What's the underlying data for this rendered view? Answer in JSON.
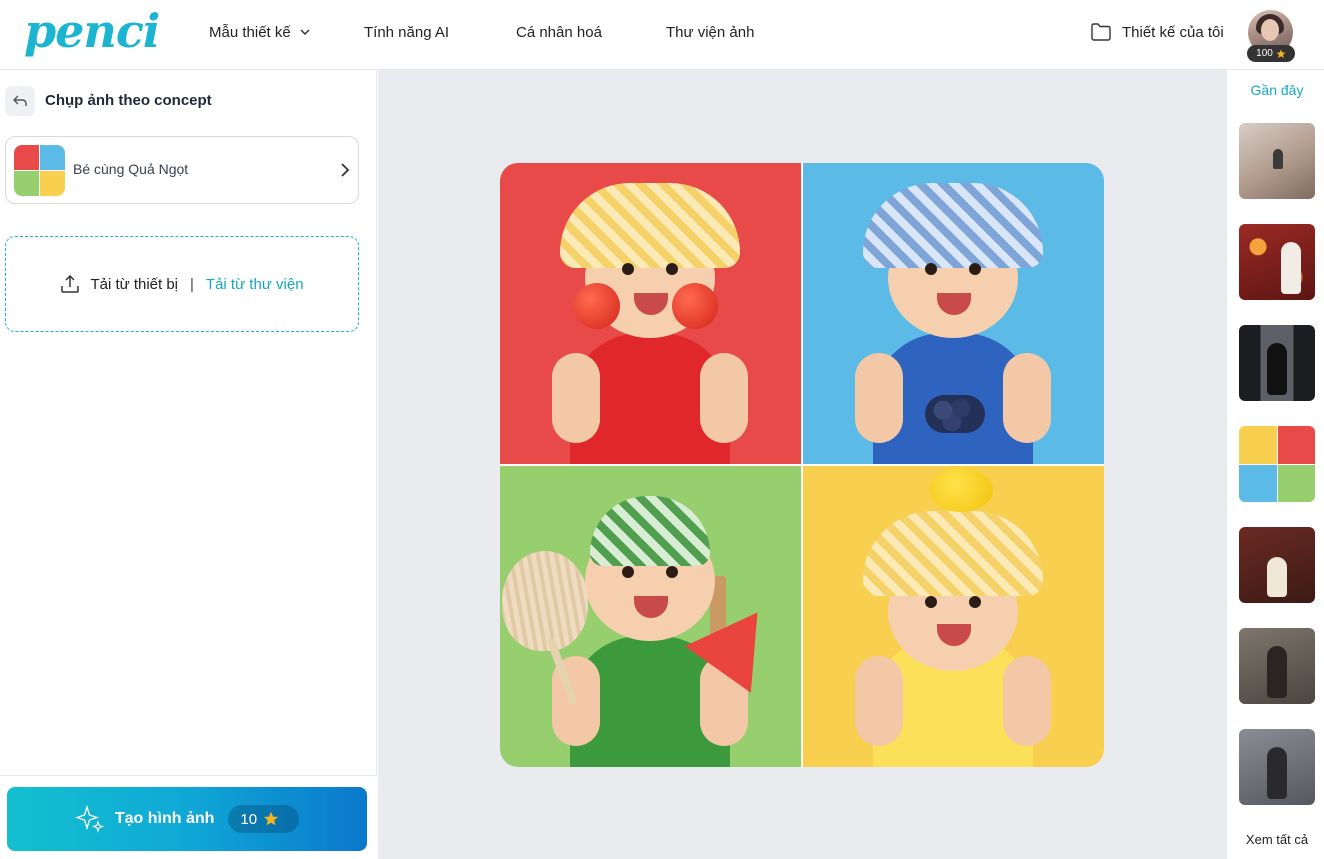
{
  "header": {
    "logo": "penci",
    "nav": [
      {
        "label": "Mẫu thiết kế",
        "has_dropdown": true
      },
      {
        "label": "Tính năng AI"
      },
      {
        "label": "Cá nhân hoá"
      },
      {
        "label": "Thư viện ảnh"
      }
    ],
    "my_designs": "Thiết kế của tôi",
    "credits": "100"
  },
  "sidebar": {
    "title": "Chụp ảnh theo concept",
    "concept_name": "Bé cùng Quả Ngọt",
    "upload_device": "Tải từ thiết bị",
    "upload_separator": "|",
    "upload_library": "Tải từ thư viện",
    "generate_label": "Tạo hình ảnh",
    "generate_cost": "10"
  },
  "recent": {
    "label": "Gần đây",
    "see_all": "Xem tất cả"
  },
  "colors": {
    "brand": "#1cb5d1",
    "accent_link": "#14a9bf",
    "canvas_bg": "#e9ebef",
    "star": "#f5b423"
  },
  "icons": [
    "chevron-down-icon",
    "folder-icon",
    "star-icon",
    "back-icon",
    "chevron-right-icon",
    "upload-icon",
    "sparkle-icon"
  ]
}
